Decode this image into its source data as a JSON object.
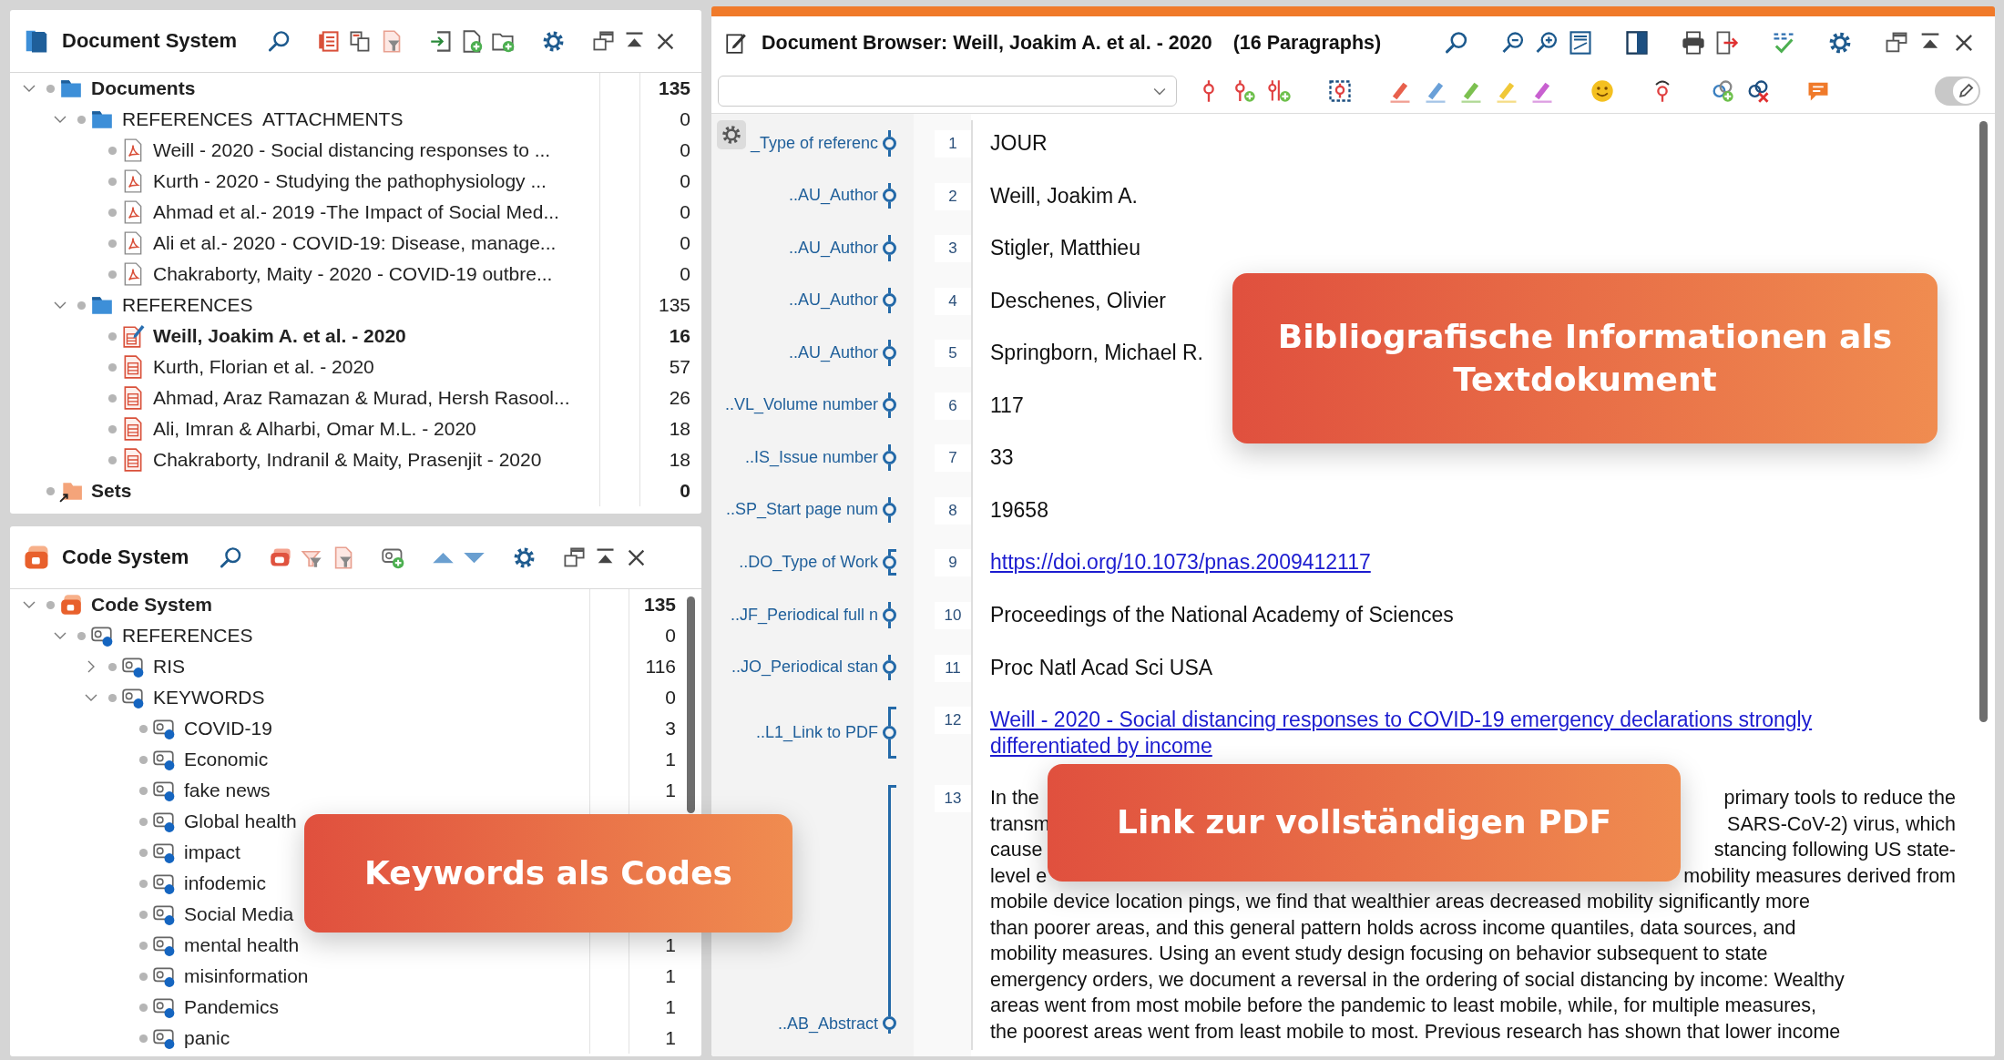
{
  "document_system": {
    "kind": "documents",
    "title": "Document System",
    "tree": [
      {
        "label": "Documents",
        "kind": "folder",
        "count": "135",
        "expanded": true,
        "children": [
          {
            "label": "REFERENCES  ATTACHMENTS",
            "kind": "folder",
            "count": "0",
            "expanded": true,
            "children": [
              {
                "label": "Weill - 2020 - Social distancing responses to ...",
                "kind": "pdf",
                "count": "0"
              },
              {
                "label": "Kurth - 2020 - Studying the pathophysiology ...",
                "kind": "pdf",
                "count": "0"
              },
              {
                "label": "Ahmad et al.- 2019 -The Impact of Social Med...",
                "kind": "pdf",
                "count": "0"
              },
              {
                "label": "Ali et al.- 2020 - COVID-19: Disease, manage...",
                "kind": "pdf",
                "count": "0"
              },
              {
                "label": "Chakraborty, Maity - 2020 - COVID-19 outbre...",
                "kind": "pdf",
                "count": "0"
              }
            ]
          },
          {
            "label": "REFERENCES",
            "kind": "folder",
            "count": "135",
            "expanded": true,
            "children": [
              {
                "label": "Weill, Joakim A. et al. - 2020",
                "kind": "text",
                "count": "16",
                "opened": true
              },
              {
                "label": "Kurth, Florian et al. - 2020",
                "kind": "text",
                "count": "57",
                "opened": false
              },
              {
                "label": "Ahmad, Araz Ramazan & Murad, Hersh Rasool...",
                "kind": "text",
                "count": "26",
                "opened": false
              },
              {
                "label": "Ali, Imran & Alharbi, Omar M.L. - 2020",
                "kind": "text",
                "count": "18",
                "opened": false
              },
              {
                "label": "Chakraborty, Indranil & Maity, Prasenjit - 2020",
                "kind": "text",
                "count": "18",
                "opened": false
              }
            ]
          }
        ]
      },
      {
        "label": "Sets",
        "kind": "set",
        "count": "0"
      }
    ]
  },
  "code_system": {
    "kind": "codes",
    "title": "Code System",
    "tree": [
      {
        "label": "Code System",
        "kind": "root",
        "count": "135",
        "expanded": true,
        "children": [
          {
            "label": "REFERENCES",
            "kind": "code",
            "count": "0",
            "expanded": true,
            "children": [
              {
                "label": "RIS",
                "kind": "code",
                "count": "116",
                "expanded": false
              },
              {
                "label": "KEYWORDS",
                "kind": "code",
                "count": "0",
                "expanded": true,
                "children": [
                  {
                    "label": "COVID-19",
                    "kind": "code",
                    "count": "3"
                  },
                  {
                    "label": "Economic",
                    "kind": "code",
                    "count": "1"
                  },
                  {
                    "label": "fake news",
                    "kind": "code",
                    "count": "1"
                  },
                  {
                    "label": "Global health",
                    "kind": "code"
                  },
                  {
                    "label": "impact",
                    "kind": "code"
                  },
                  {
                    "label": "infodemic",
                    "kind": "code"
                  },
                  {
                    "label": "Social Media",
                    "kind": "code"
                  },
                  {
                    "label": "mental health",
                    "kind": "code",
                    "count": "1"
                  },
                  {
                    "label": "misinformation",
                    "kind": "code",
                    "count": "1"
                  },
                  {
                    "label": "Pandemics",
                    "kind": "code",
                    "count": "1"
                  },
                  {
                    "label": "panic",
                    "kind": "code",
                    "count": "1"
                  }
                ]
              }
            ]
          }
        ]
      }
    ]
  },
  "document_browser": {
    "title": "Document Browser: Weill, Joakim A. et al. - 2020",
    "paragraph_count": "(16 Paragraphs)",
    "edit_mode": {
      "on": true
    },
    "paragraphs": [
      {
        "kind": "text",
        "code": "_Type of referenc",
        "number": "1",
        "text": "JOUR"
      },
      {
        "kind": "text",
        "code": "..AU_Author",
        "number": "2",
        "text": "Weill, Joakim A."
      },
      {
        "kind": "text",
        "code": "..AU_Author",
        "number": "3",
        "text": "Stigler, Matthieu"
      },
      {
        "kind": "text",
        "code": "..AU_Author",
        "number": "4",
        "text": "Deschenes, Olivier"
      },
      {
        "kind": "text",
        "code": "..AU_Author",
        "number": "5",
        "text": "Springborn, Michael R."
      },
      {
        "kind": "text",
        "code": "..VL_Volume number",
        "number": "6",
        "text": "117"
      },
      {
        "kind": "text",
        "code": "..IS_Issue number",
        "number": "7",
        "text": "33"
      },
      {
        "kind": "text",
        "code": "..SP_Start page num",
        "number": "8",
        "text": "19658"
      },
      {
        "kind": "link",
        "code": "..DO_Type of Work",
        "number": "9",
        "text": "https://doi.org/10.1073/pnas.2009412117"
      },
      {
        "kind": "text",
        "code": "..JF_Periodical full n",
        "number": "10",
        "text": "Proceedings of the National Academy of Sciences"
      },
      {
        "kind": "text",
        "code": "..JO_Periodical stan",
        "number": "11",
        "text": "Proc Natl Acad Sci USA"
      },
      {
        "kind": "link",
        "code": "..L1_Link to PDF",
        "number": "12",
        "text": "Weill - 2020 - Social distancing responses to COVID-19 emergency declarations strongly differentiated by income"
      },
      {
        "kind": "abstract",
        "code": "..AB_Abstract",
        "number": "13",
        "lines": [
          {
            "left": "In the",
            "right": "primary tools to reduce the"
          },
          {
            "left": "transm",
            "right": "SARS-CoV-2) virus, which"
          },
          {
            "left": "cause",
            "right": "stancing following US state-"
          },
          {
            "left": "level e",
            "right": "mobility measures derived from"
          },
          {
            "text": "mobile device location pings, we find that wealthier areas decreased mobility significantly more"
          },
          {
            "text": "than poorer areas, and this general pattern holds across income quantiles, data sources, and"
          },
          {
            "text": "mobility measures. Using an event study design focusing on behavior subsequent to state"
          },
          {
            "text": "emergency orders, we document a reversal in the ordering of social distancing by income: Wealthy"
          },
          {
            "text": "areas went from most mobile before the pandemic to least mobile, while, for multiple measures,"
          },
          {
            "text": "the poorest areas went from least mobile to most. Previous research has shown that lower income"
          }
        ]
      }
    ]
  },
  "callouts": [
    {
      "text": "Bibliografische Informationen als Textdokument"
    },
    {
      "text": "Link zur vollständigen PDF"
    },
    {
      "text": "Keywords als Codes"
    }
  ]
}
